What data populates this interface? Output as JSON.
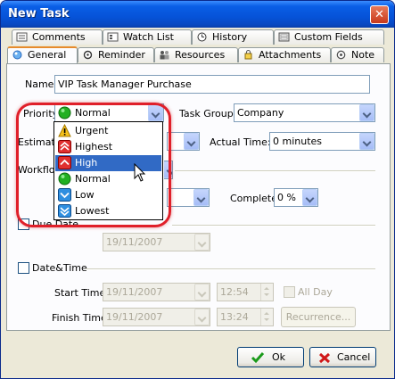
{
  "window": {
    "title": "New Task",
    "close_label": "✕"
  },
  "tabs_row1": [
    "Comments",
    "Watch List",
    "History",
    "Custom Fields"
  ],
  "tabs_row2": [
    "General",
    "Reminder",
    "Resources",
    "Attachments",
    "Note"
  ],
  "form": {
    "name_label": "Name:",
    "name_value": "VIP Task Manager Purchase",
    "priority_label": "Priority:",
    "priority_value": "Normal",
    "task_group_label": "Task Group:",
    "task_group_value": "Company",
    "estimated_label": "Estimated",
    "actual_time_label": "Actual Time:",
    "actual_time_value": "0 minutes",
    "workflow_label": "Workflow",
    "complete_label": "Complete:",
    "complete_value": "0 %",
    "due_date_label": "Due Date",
    "due_date_value": "19/11/2007",
    "datetime_label": "Date&Time",
    "start_time_label": "Start Time:",
    "start_date_value": "19/11/2007",
    "start_time_value": "12:54",
    "all_day_label": "All Day",
    "finish_time_label": "Finish Time:",
    "finish_date_value": "19/11/2007",
    "finish_time_value": "13:24",
    "recurrence_label": "Recurrence..."
  },
  "priority_options": [
    {
      "label": "Urgent",
      "icon": "urgent-icon"
    },
    {
      "label": "Highest",
      "icon": "highest-icon"
    },
    {
      "label": "High",
      "icon": "high-icon",
      "selected": true
    },
    {
      "label": "Normal",
      "icon": "normal-icon"
    },
    {
      "label": "Low",
      "icon": "low-icon"
    },
    {
      "label": "Lowest",
      "icon": "lowest-icon"
    }
  ],
  "buttons": {
    "ok": "Ok",
    "cancel": "Cancel"
  },
  "colors": {
    "titlebar": "#0653d8",
    "highlight": "#e0202a",
    "selection": "#316ac5"
  }
}
